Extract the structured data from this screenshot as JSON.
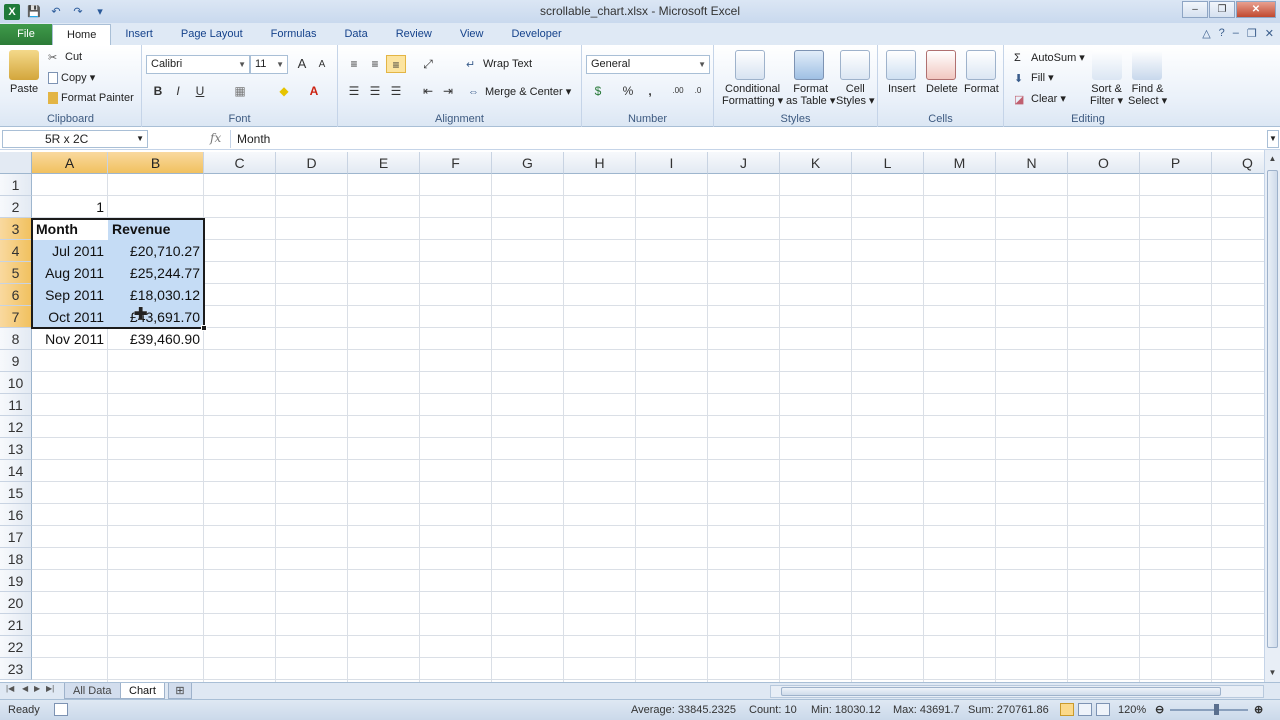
{
  "window": {
    "title": "scrollable_chart.xlsx - Microsoft Excel",
    "controls": {
      "minimize": "–",
      "restore": "❐",
      "close": "✕"
    }
  },
  "qat": {
    "logo": "X",
    "save_icon": "save-icon",
    "undo_icon": "undo-icon",
    "redo_icon": "redo-icon"
  },
  "ribbon_tabs": [
    "File",
    "Home",
    "Insert",
    "Page Layout",
    "Formulas",
    "Data",
    "Review",
    "View",
    "Developer"
  ],
  "active_tab": "Home",
  "ribbon": {
    "clipboard": {
      "label": "Clipboard",
      "paste": "Paste",
      "cut": "Cut",
      "copy": "Copy ▾",
      "format_painter": "Format Painter"
    },
    "font": {
      "label": "Font",
      "name": "Calibri",
      "size": "11",
      "bold": "B",
      "italic": "I",
      "underline": "U",
      "grow": "A",
      "shrink": "A"
    },
    "alignment": {
      "label": "Alignment",
      "wrap_text": "Wrap Text",
      "merge_center": "Merge & Center"
    },
    "number": {
      "label": "Number",
      "format": "General",
      "percent": "%",
      "comma": ",",
      "inc_dec": ".00",
      "dec_dec": ".0"
    },
    "styles": {
      "label": "Styles",
      "conditional_formatting": [
        "Conditional",
        "Formatting ▾"
      ],
      "format_as_table": [
        "Format",
        "as Table ▾"
      ],
      "cell_styles": [
        "Cell",
        "Styles ▾"
      ]
    },
    "cells": {
      "label": "Cells",
      "insert": "Insert",
      "delete": "Delete",
      "format": "Format"
    },
    "editing": {
      "label": "Editing",
      "autosum": "AutoSum",
      "fill": "Fill",
      "clear": "Clear",
      "sort_filter": [
        "Sort &",
        "Filter ▾"
      ],
      "find_select": [
        "Find &",
        "Select ▾"
      ]
    }
  },
  "formula_bar": {
    "name_box": "5R x 2C",
    "fx": "fx",
    "content": "Month"
  },
  "columns": [
    "A",
    "B",
    "C",
    "D",
    "E",
    "F",
    "G",
    "H",
    "I",
    "J",
    "K",
    "L",
    "M",
    "N",
    "O",
    "P",
    "Q"
  ],
  "rows": [
    "1",
    "2",
    "3",
    "4",
    "5",
    "6",
    "7",
    "8",
    "9",
    "10",
    "11",
    "12",
    "13",
    "14",
    "15",
    "16",
    "17",
    "18",
    "19",
    "20",
    "21",
    "22",
    "23"
  ],
  "cells": {
    "B2": "1",
    "A3": "Month",
    "B3": "Revenue",
    "A4": "Jul 2011",
    "B4": "£20,710.27",
    "A5": "Aug 2011",
    "B5": "£25,244.77",
    "A6": "Sep 2011",
    "B6": "£18,030.12",
    "A7": "Oct 2011",
    "B7": "£43,691.70",
    "A8": "Nov 2011",
    "B8": "£39,460.90"
  },
  "sheet_tabs": [
    "All Data",
    "Chart"
  ],
  "active_sheet": "Chart",
  "status": {
    "ready": "Ready",
    "average": "Average: 33845.2325",
    "count": "Count: 10",
    "min": "Min: 18030.12",
    "max": "Max: 43691.7",
    "sum": "Sum: 270761.86",
    "zoom": "120%"
  },
  "colors": {
    "selection_fill": "#c5dcf5",
    "header_selected": "#f1c15f",
    "file_tab": "#2c7b37"
  }
}
